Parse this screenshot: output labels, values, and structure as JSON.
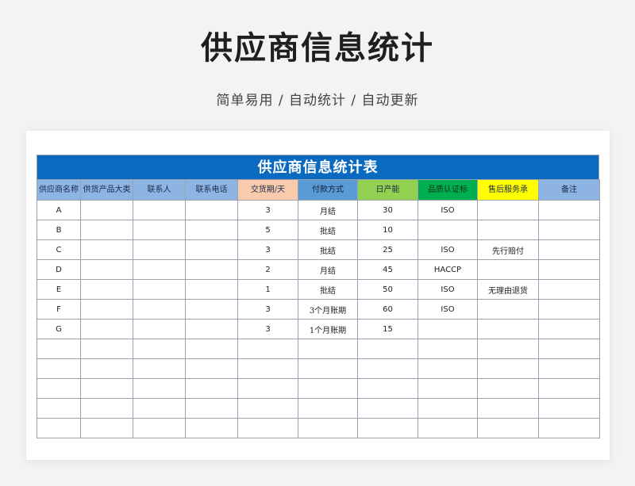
{
  "page_title": "供应商信息统计",
  "subtitle": "简单易用 / 自动统计 / 自动更新",
  "sheet": {
    "title": "供应商信息统计表",
    "headers": [
      "供应商名称",
      "供货产品大类",
      "联系人",
      "联系电话",
      "交货期/天",
      "付款方式",
      "日产能",
      "品质认证标",
      "售后服务承",
      "备注"
    ],
    "rows": [
      {
        "name": "A",
        "category": "",
        "contact": "",
        "phone": "",
        "delivery_days": "3",
        "payment": "月结",
        "capacity": "30",
        "certification": "ISO",
        "after_sales": "",
        "remark": ""
      },
      {
        "name": "B",
        "category": "",
        "contact": "",
        "phone": "",
        "delivery_days": "5",
        "payment": "批结",
        "capacity": "10",
        "certification": "",
        "after_sales": "",
        "remark": ""
      },
      {
        "name": "C",
        "category": "",
        "contact": "",
        "phone": "",
        "delivery_days": "3",
        "payment": "批结",
        "capacity": "25",
        "certification": "ISO",
        "after_sales": "先行赔付",
        "remark": ""
      },
      {
        "name": "D",
        "category": "",
        "contact": "",
        "phone": "",
        "delivery_days": "2",
        "payment": "月结",
        "capacity": "45",
        "certification": "HACCP",
        "after_sales": "",
        "remark": ""
      },
      {
        "name": "E",
        "category": "",
        "contact": "",
        "phone": "",
        "delivery_days": "1",
        "payment": "批结",
        "capacity": "50",
        "certification": "ISO",
        "after_sales": "无理由退货",
        "remark": ""
      },
      {
        "name": "F",
        "category": "",
        "contact": "",
        "phone": "",
        "delivery_days": "3",
        "payment": "3个月账期",
        "capacity": "60",
        "certification": "ISO",
        "after_sales": "",
        "remark": ""
      },
      {
        "name": "G",
        "category": "",
        "contact": "",
        "phone": "",
        "delivery_days": "3",
        "payment": "1个月账期",
        "capacity": "15",
        "certification": "",
        "after_sales": "",
        "remark": ""
      }
    ],
    "empty_row_count": 5
  },
  "colors": {
    "title_bar": "#0a6abf",
    "header_default": "#8db4e2",
    "header_delivery": "#f8cbad",
    "header_payment": "#5b9bd5",
    "header_capacity": "#92d050",
    "header_certification": "#00b050",
    "header_after_sales": "#ffff00",
    "delivery_text": "#e07b12",
    "payment_text": "#2e8fb5",
    "capacity_text": "#1aa34a"
  }
}
